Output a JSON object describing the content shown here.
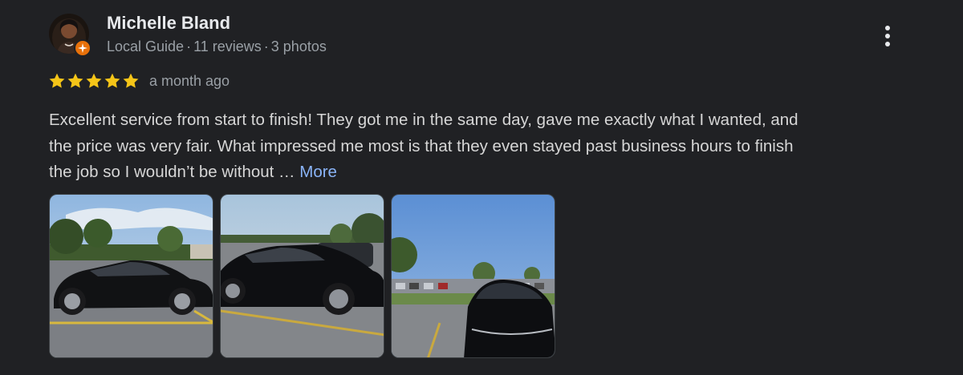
{
  "reviewer": {
    "name": "Michelle Bland",
    "badge": "Local Guide",
    "reviews": "11 reviews",
    "photos": "3 photos",
    "separator": "·"
  },
  "rating": {
    "stars": 5,
    "max_stars": 5,
    "star_color": "#f5c518",
    "date": "a month ago"
  },
  "review": {
    "line1": "Excellent service from start to finish! They got me in the same day, gave me exactly what I wanted, and",
    "line2": "the price was very fair. What impressed me most is that they even stayed past business hours to finish",
    "line3": "the job so I wouldn’t be without …",
    "more_label": "More"
  },
  "photos": [
    {
      "name": "black car in parking lot side view"
    },
    {
      "name": "black car parked near curb"
    },
    {
      "name": "black car front view in lot"
    }
  ],
  "colors": {
    "background": "#202124",
    "link": "#8ab4f8",
    "badge": "#e8710a"
  }
}
